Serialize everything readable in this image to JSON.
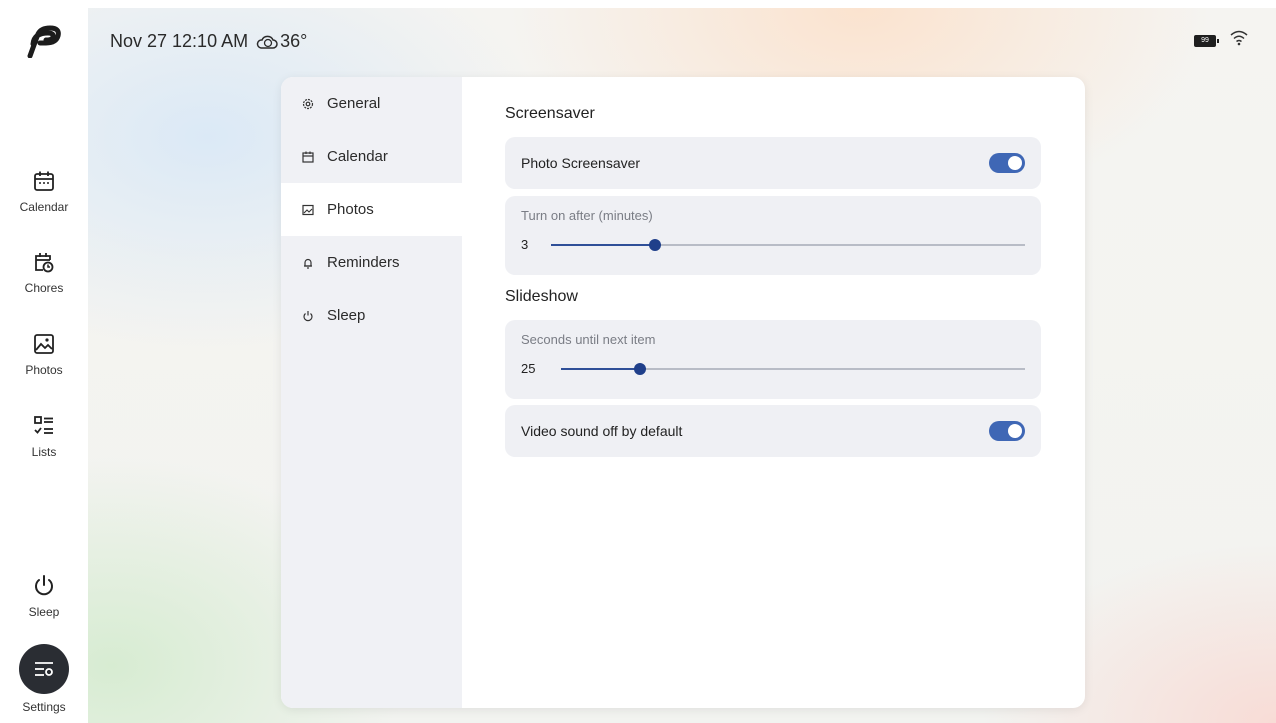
{
  "status": {
    "datetime": "Nov 27 12:10 AM",
    "temperature": "36°",
    "weather_icon": "cloudy-icon",
    "battery_level": "99",
    "wifi_icon": "wifi-icon"
  },
  "rail": {
    "items": [
      {
        "label": "Calendar",
        "icon": "calendar-icon"
      },
      {
        "label": "Chores",
        "icon": "chores-icon"
      },
      {
        "label": "Photos",
        "icon": "photos-icon"
      },
      {
        "label": "Lists",
        "icon": "lists-icon"
      },
      {
        "label": "Sleep",
        "icon": "power-icon"
      },
      {
        "label": "Settings",
        "icon": "settings-icon"
      }
    ]
  },
  "settings_nav": {
    "items": [
      {
        "label": "General",
        "icon": "gear-icon",
        "active": false
      },
      {
        "label": "Calendar",
        "icon": "calendar-icon",
        "active": false
      },
      {
        "label": "Photos",
        "icon": "image-icon",
        "active": true
      },
      {
        "label": "Reminders",
        "icon": "bell-icon",
        "active": false
      },
      {
        "label": "Sleep",
        "icon": "power-icon",
        "active": false
      }
    ]
  },
  "screensaver": {
    "title": "Screensaver",
    "photo_screensaver_label": "Photo Screensaver",
    "photo_screensaver_on": true,
    "turn_on_after_label": "Turn on after (minutes)",
    "turn_on_after_value": "3",
    "turn_on_after_fraction": 0.22
  },
  "slideshow": {
    "title": "Slideshow",
    "seconds_label": "Seconds until next item",
    "seconds_value": "25",
    "seconds_fraction": 0.17,
    "video_sound_label": "Video sound off by default",
    "video_sound_on": true
  },
  "colors": {
    "accent": "#3f67b5",
    "slider_thumb": "#1f3f8a",
    "nav_bg": "#f0f1f5",
    "row_bg": "#eff0f4",
    "settings_button": "#2a2d33"
  }
}
